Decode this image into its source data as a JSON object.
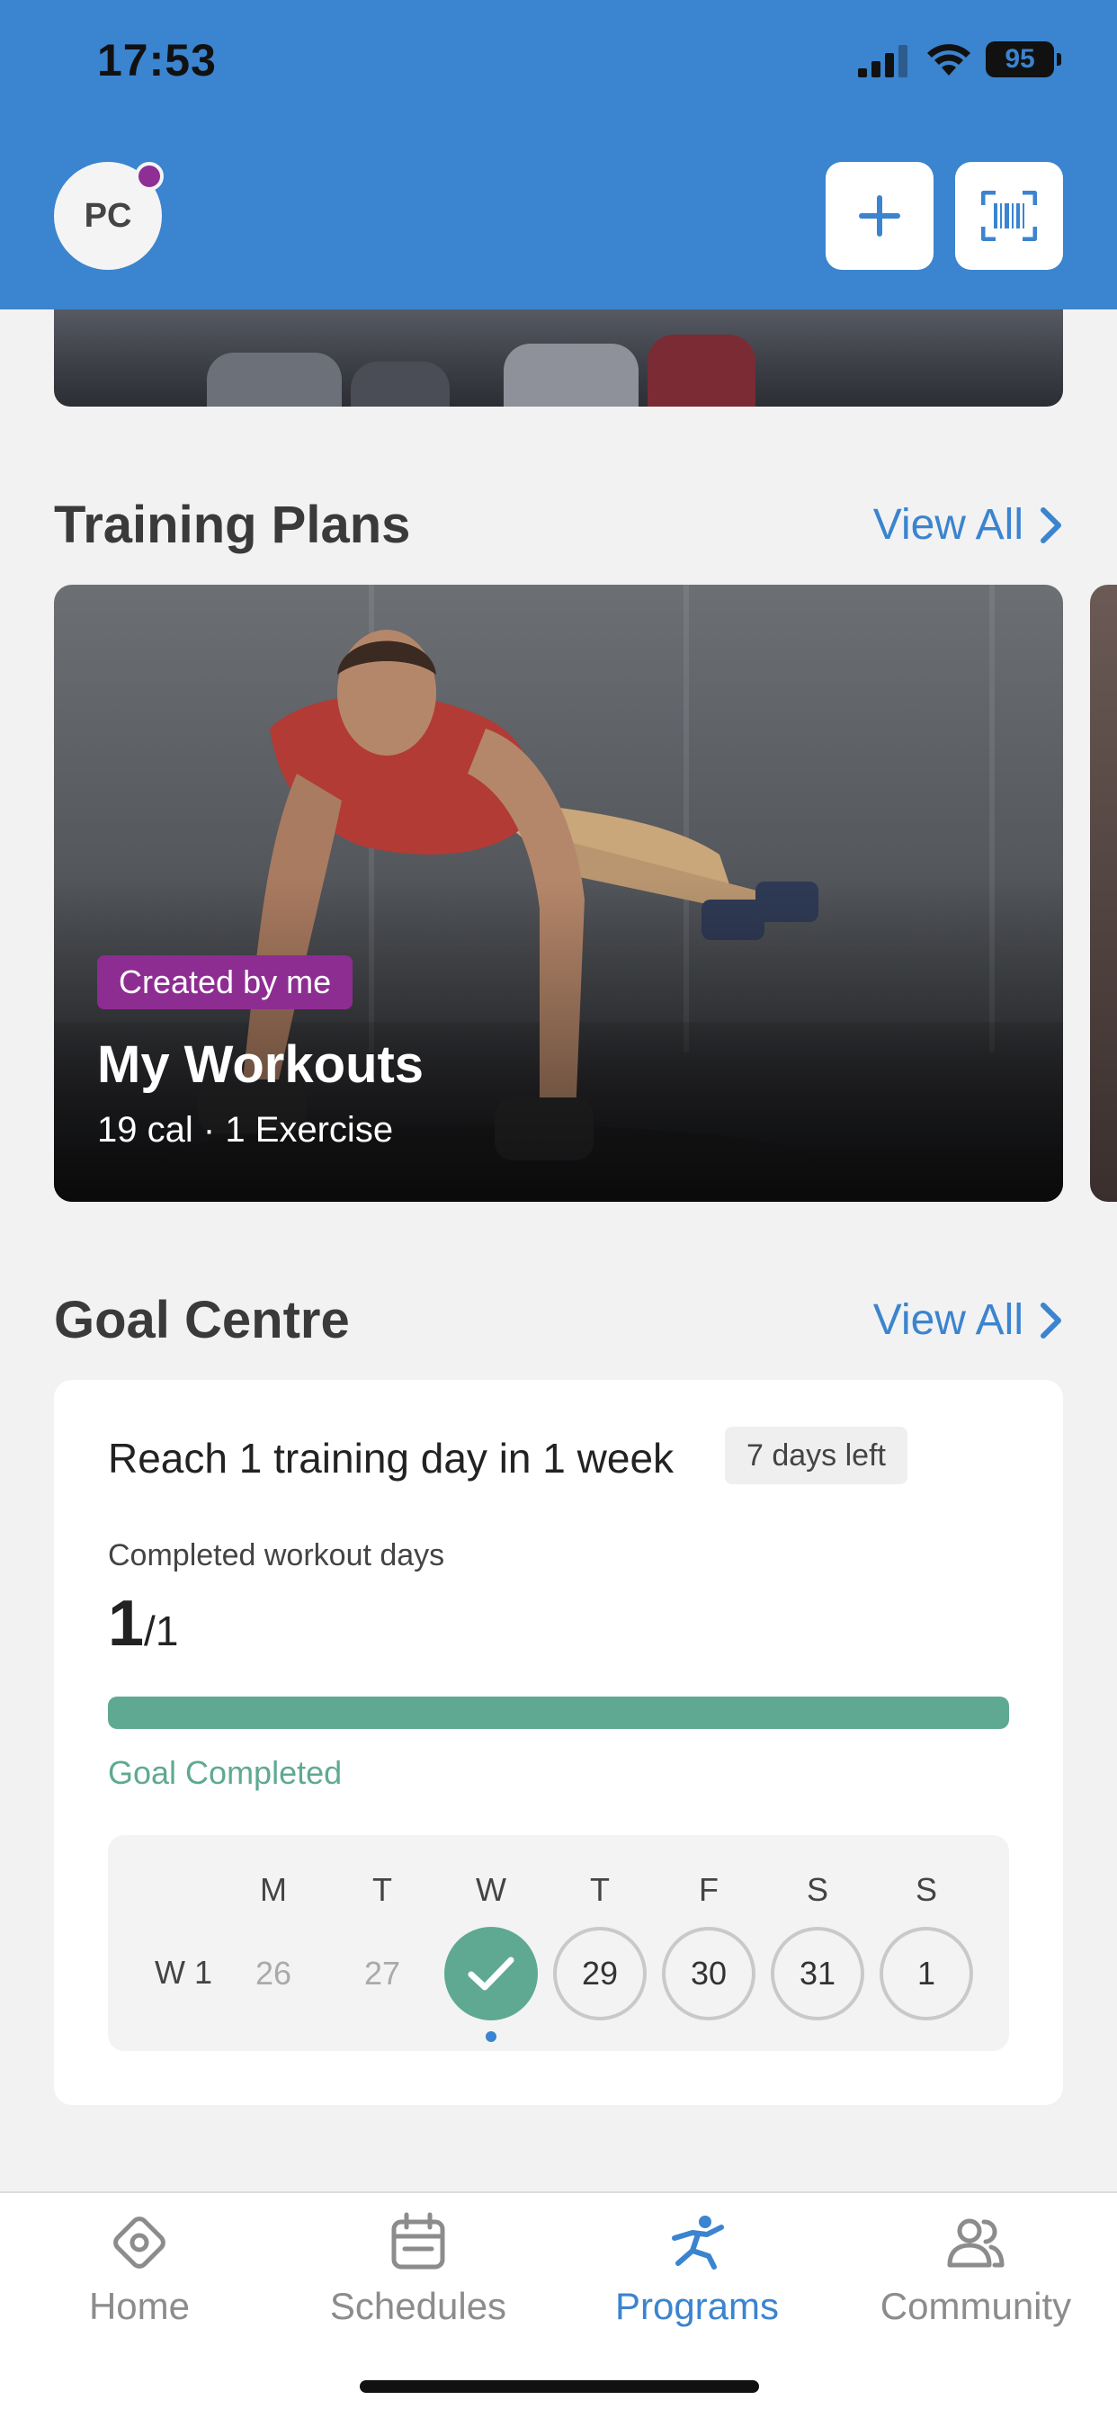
{
  "status_bar": {
    "time": "17:53",
    "battery": "95"
  },
  "header": {
    "avatar_initials": "PC",
    "colors": {
      "header_bg": "#3b84cf",
      "notification_dot": "#8e2f96"
    },
    "actions": [
      {
        "icon": "plus-icon"
      },
      {
        "icon": "barcode-scan-icon"
      }
    ]
  },
  "training_plans": {
    "title": "Training Plans",
    "view_all": "View All",
    "card": {
      "badge": "Created by me",
      "title": "My Workouts",
      "calories": "19 cal",
      "separator": "·",
      "exercises": "1 Exercise",
      "badge_color": "#8d2d92"
    }
  },
  "goal_centre": {
    "title": "Goal Centre",
    "view_all": "View All",
    "goal": {
      "title": "Reach 1 training day in 1 week",
      "days_left": "7 days left",
      "subtitle": "Completed workout days",
      "completed": "1",
      "target": "/1",
      "progress_fraction": 1.0,
      "status": "Goal Completed",
      "accent": "#5fa993"
    },
    "week": {
      "label": "W 1",
      "day_headers": [
        "M",
        "T",
        "W",
        "T",
        "F",
        "S",
        "S"
      ],
      "days": [
        {
          "num": "26",
          "state": "past"
        },
        {
          "num": "27",
          "state": "past"
        },
        {
          "num": "",
          "state": "done",
          "icon": "checkmark-icon"
        },
        {
          "num": "29",
          "state": "future"
        },
        {
          "num": "30",
          "state": "future"
        },
        {
          "num": "31",
          "state": "future"
        },
        {
          "num": "1",
          "state": "future"
        }
      ]
    }
  },
  "bottom_nav": {
    "items": [
      {
        "label": "Home",
        "icon": "home-icon",
        "active": false
      },
      {
        "label": "Schedules",
        "icon": "calendar-icon",
        "active": false
      },
      {
        "label": "Programs",
        "icon": "running-figure-icon",
        "active": true
      },
      {
        "label": "Community",
        "icon": "people-icon",
        "active": false
      }
    ],
    "active_color": "#3b84cf",
    "inactive_color": "#8c8c8c"
  }
}
